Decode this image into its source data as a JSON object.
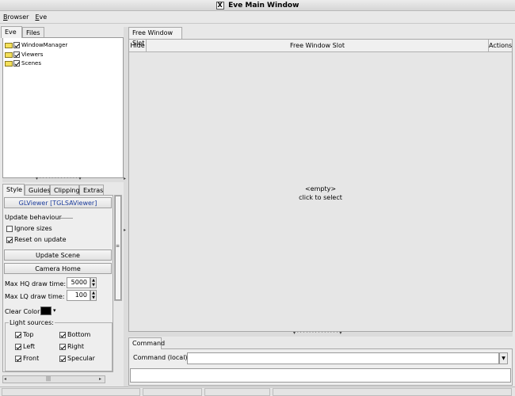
{
  "window": {
    "title": "Eve Main Window"
  },
  "menubar": {
    "items": [
      "Browser",
      "Eve"
    ]
  },
  "left_tabs": [
    "Eve",
    "Files"
  ],
  "tree": {
    "items": [
      {
        "label": "WindowManager",
        "checked": true
      },
      {
        "label": "Viewers",
        "checked": true
      },
      {
        "label": "Scenes",
        "checked": true
      }
    ]
  },
  "style_tabs": [
    "Style",
    "Guides",
    "Clipping",
    "Extras"
  ],
  "style": {
    "viewer_button": "GLViewer [TGLSAViewer]",
    "update_behaviour": "Update behaviour",
    "ignore_sizes": "Ignore sizes",
    "reset_on_update": "Reset on update",
    "update_scene": "Update Scene",
    "camera_home": "Camera Home",
    "max_hq_label": "Max HQ draw time:",
    "max_hq_value": "5000",
    "max_lq_label": "Max LQ draw time:",
    "max_lq_value": "100",
    "clear_color": "Clear Color",
    "clear_color_value": "#000000",
    "light_sources": "Light sources:",
    "lights": [
      "Top",
      "Bottom",
      "Left",
      "Right",
      "Front",
      "Specular"
    ]
  },
  "right_tab": "Free Window Slot",
  "slot": {
    "hide": "Hide",
    "title": "Free Window Slot",
    "actions": "Actions",
    "empty": "<empty>",
    "hint": "click to select"
  },
  "command": {
    "tab": "Command",
    "label": "Command (local):"
  }
}
